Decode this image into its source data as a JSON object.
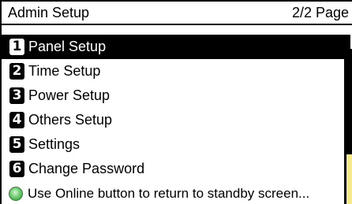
{
  "header": {
    "title": "Admin Setup",
    "page_indicator": "2/2 Page"
  },
  "menu": {
    "items": [
      {
        "number": "1",
        "label": "Panel Setup",
        "selected": true
      },
      {
        "number": "2",
        "label": "Time Setup",
        "selected": false
      },
      {
        "number": "3",
        "label": "Power Setup",
        "selected": false
      },
      {
        "number": "4",
        "label": "Others Setup",
        "selected": false
      },
      {
        "number": "5",
        "label": "Settings",
        "selected": false
      },
      {
        "number": "6",
        "label": "Change Password",
        "selected": false
      }
    ]
  },
  "footer": {
    "icon": "online-led-icon",
    "message": "Use Online button to return to standby screen..."
  },
  "colors": {
    "selected_bg": "#000000",
    "selected_fg": "#ffffff",
    "led_green": "#6fcf6f",
    "sidebar_accent": "#f5e98a"
  }
}
